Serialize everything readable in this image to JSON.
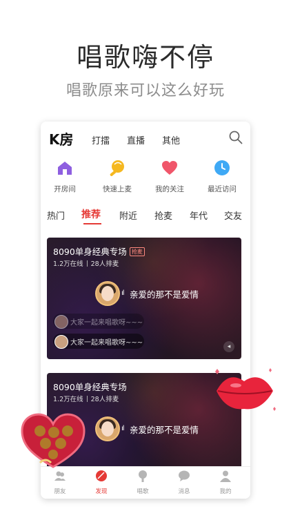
{
  "hero": {
    "title": "唱歌嗨不停",
    "subtitle": "唱歌原来可以这么好玩"
  },
  "app": {
    "brand": "K房",
    "top_tabs": [
      "打擂",
      "直播",
      "其他"
    ],
    "search_icon": "search-icon",
    "quick_actions": [
      {
        "label": "开房间",
        "icon": "house-icon",
        "color": "#8e5fe0"
      },
      {
        "label": "快速上麦",
        "icon": "microphone-icon",
        "color": "#f5b820"
      },
      {
        "label": "我的关注",
        "icon": "heart-icon",
        "color": "#f0566a"
      },
      {
        "label": "最近访问",
        "icon": "clock-icon",
        "color": "#3fa9f5"
      }
    ],
    "categories": [
      "热门",
      "推荐",
      "附近",
      "抢麦",
      "年代",
      "交友"
    ],
    "active_category": "推荐",
    "rooms": [
      {
        "title": "8090单身经典专场",
        "badge": "抢麦",
        "online": "1.2万在线",
        "queue": "28人排麦",
        "song": "亲爱的那不是爱情",
        "chats": [
          "大家一起来唱歌呀~~~",
          "大家一起来唱歌呀~~~"
        ]
      },
      {
        "title": "8090单身经典专场",
        "online": "1.2万在线",
        "queue": "28人排麦",
        "song": "亲爱的那不是爱情"
      }
    ],
    "tabbar": [
      {
        "label": "朋友",
        "icon": "friends-icon"
      },
      {
        "label": "发现",
        "icon": "discover-icon"
      },
      {
        "label": "唱歌",
        "icon": "microphone-icon"
      },
      {
        "label": "消息",
        "icon": "message-icon"
      },
      {
        "label": "我的",
        "icon": "profile-icon"
      }
    ],
    "active_tab": "发现",
    "accent_color": "#e53935"
  }
}
